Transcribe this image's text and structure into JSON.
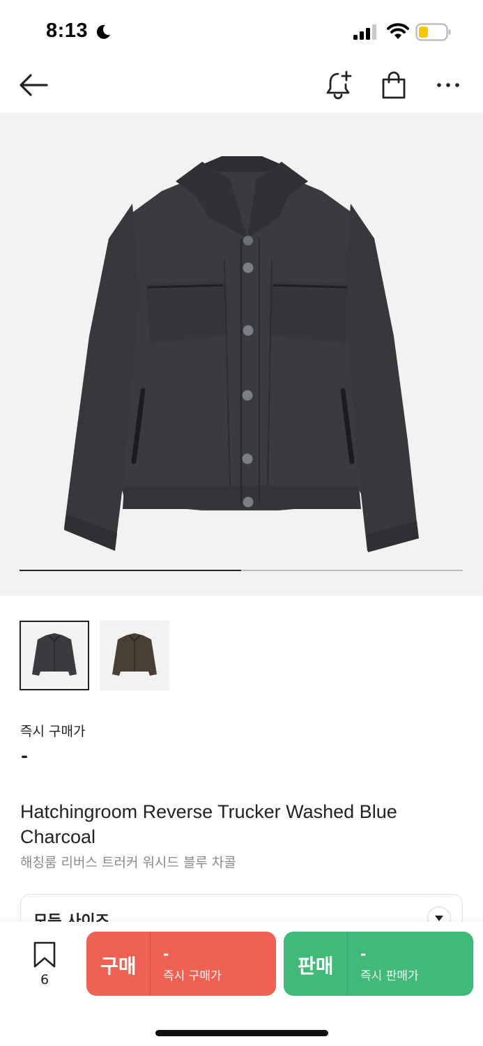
{
  "status_bar": {
    "time": "8:13",
    "icons": [
      "moon-icon",
      "signal-icon",
      "wifi-icon",
      "battery-icon"
    ]
  },
  "nav": {
    "icons": [
      "back-arrow-icon",
      "bell-plus-icon",
      "shopping-bag-icon",
      "more-icon"
    ]
  },
  "gallery": {
    "progress": 0.5,
    "thumbnail_count": 2
  },
  "price": {
    "label": "즉시 구매가",
    "value": "-"
  },
  "product": {
    "title": "Hatchingroom Reverse Trucker Washed Blue Charcoal",
    "subtitle": "해칭룸 리버스 트러커 워시드 블루 차콜"
  },
  "size": {
    "label": "모든 사이즈"
  },
  "bottom": {
    "wish_count": "6",
    "buy": {
      "label": "구매",
      "price": "-",
      "sub": "즉시 구매가"
    },
    "sell": {
      "label": "판매",
      "price": "-",
      "sub": "즉시 판매가"
    }
  },
  "colors": {
    "buy": "#ef6253",
    "sell": "#41b979",
    "jacket_charcoal": "#3a3b3e",
    "jacket_brown": "#4a3f35"
  }
}
